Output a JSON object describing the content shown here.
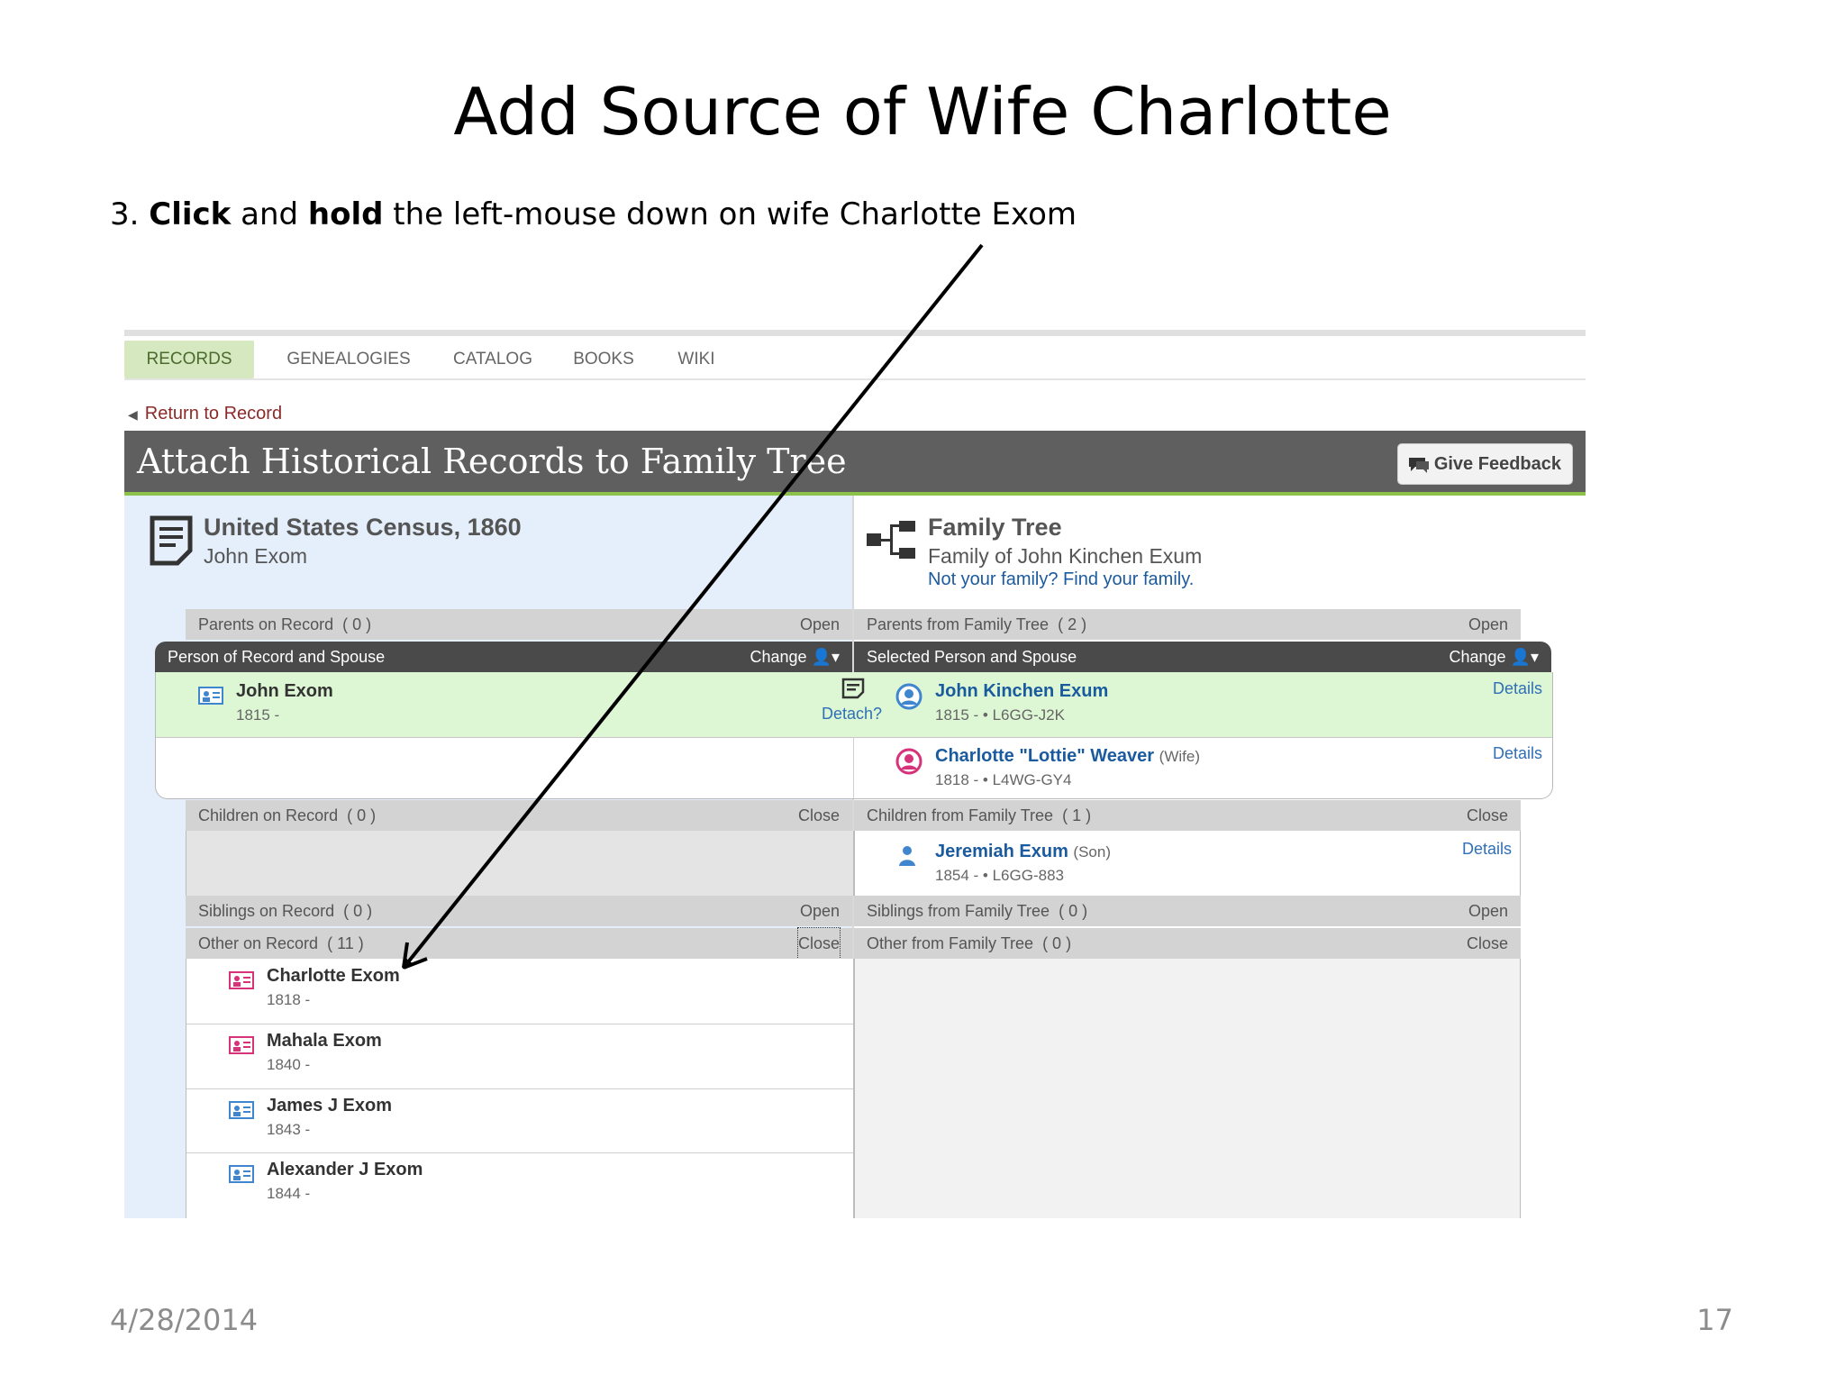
{
  "slide": {
    "title": "Add Source of Wife Charlotte",
    "instruction": {
      "number": "3.",
      "bold1": "Click",
      "mid1": "and",
      "bold2": "hold",
      "rest": "the left-mouse down on wife Charlotte Exom"
    },
    "date": "4/28/2014",
    "page_number": "17"
  },
  "screenshot": {
    "nav_tabs": [
      "RECORDS",
      "GENEALOGIES",
      "CATALOG",
      "BOOKS",
      "WIKI"
    ],
    "active_tab": "RECORDS",
    "return_link": "Return to Record",
    "banner_title": "Attach Historical Records to Family Tree",
    "feedback_button": "Give Feedback",
    "source": {
      "title": "United States Census, 1860",
      "subtitle": "John Exom"
    },
    "family_tree": {
      "title": "Family Tree",
      "subtitle": "Family of John Kinchen Exum",
      "link": "Not your family? Find your family."
    },
    "sections": {
      "parents_record": {
        "label": "Parents on Record",
        "count": "( 0 )",
        "action": "Open"
      },
      "parents_tree": {
        "label": "Parents from Family Tree",
        "count": "( 2 )",
        "action": "Open"
      },
      "person_record": {
        "label": "Person of Record and Spouse",
        "action": "Change"
      },
      "person_tree": {
        "label": "Selected Person and Spouse",
        "action": "Change"
      },
      "children_record": {
        "label": "Children on Record",
        "count": "( 0 )",
        "action": "Close"
      },
      "children_tree": {
        "label": "Children from Family Tree",
        "count": "( 1 )",
        "action": "Close"
      },
      "siblings_record": {
        "label": "Siblings on Record",
        "count": "( 0 )",
        "action": "Open"
      },
      "siblings_tree": {
        "label": "Siblings from Family Tree",
        "count": "( 0 )",
        "action": "Open"
      },
      "other_record": {
        "label": "Other on Record",
        "count": "( 11 )",
        "action": "Close"
      },
      "other_tree": {
        "label": "Other from Family Tree",
        "count": "( 0 )",
        "action": "Close"
      }
    },
    "record_person": {
      "name": "John Exom",
      "dates": "1815 -"
    },
    "detach_label": "Detach?",
    "tree_person": {
      "name": "John Kinchen Exum",
      "meta": "1815 - • L6GG-J2K",
      "details": "Details"
    },
    "tree_spouse": {
      "name": "Charlotte \"Lottie\" Weaver",
      "relation": "(Wife)",
      "meta": "1818 - • L4WG-GY4",
      "details": "Details"
    },
    "tree_child": {
      "name": "Jeremiah Exum",
      "relation": "(Son)",
      "meta": "1854 - • L6GG-883",
      "details": "Details"
    },
    "other_record_people": [
      {
        "name": "Charlotte Exom",
        "dates": "1818 -",
        "gender": "female"
      },
      {
        "name": "Mahala Exom",
        "dates": "1840 -",
        "gender": "female"
      },
      {
        "name": "James J Exom",
        "dates": "1843 -",
        "gender": "male"
      },
      {
        "name": "Alexander J Exom",
        "dates": "1844 -",
        "gender": "male"
      }
    ]
  },
  "colors": {
    "banner": "#5f5f5f",
    "banner_accent": "#8cc24a",
    "person_highlight": "#ddf7d4",
    "record_column": "#e4effb",
    "link_blue": "#1a5a9e",
    "female_icon": "#d6337a",
    "male_icon": "#3f86cf"
  },
  "icons": {
    "record": "record-card-icon",
    "tree": "family-tree-icon",
    "source": "source-document-icon",
    "feedback": "feedback-bubble-icon",
    "arrow": "pointer-arrow"
  }
}
